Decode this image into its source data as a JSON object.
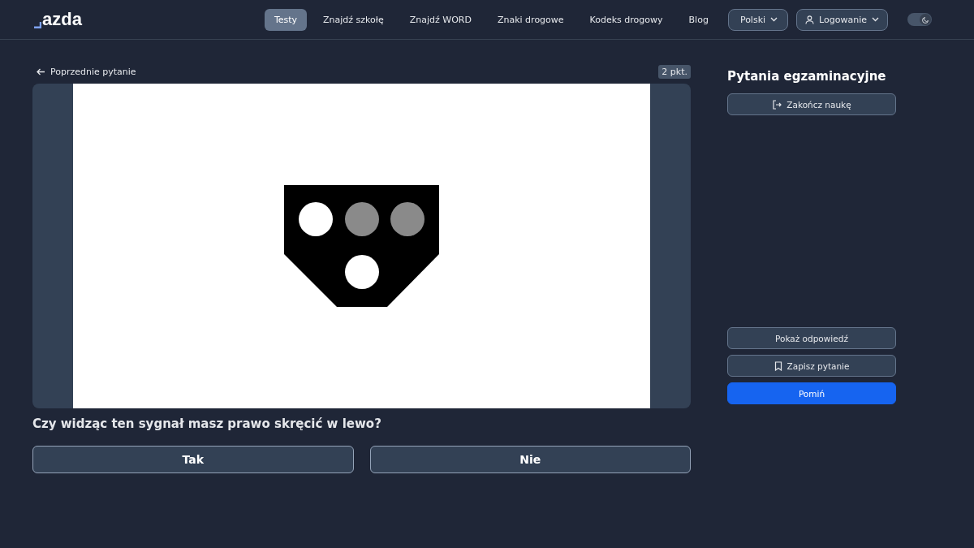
{
  "header": {
    "logo": "azda",
    "nav": [
      {
        "label": "Testy",
        "selected": true
      },
      {
        "label": "Znajdź szkołę",
        "selected": false
      },
      {
        "label": "Znajdź WORD",
        "selected": false
      },
      {
        "label": "Znaki drogowe",
        "selected": false
      },
      {
        "label": "Kodeks drogowy",
        "selected": false
      },
      {
        "label": "Blog",
        "selected": false
      }
    ],
    "language": "Polski",
    "login": "Logowanie",
    "theme_toggle": {
      "on": true
    }
  },
  "question": {
    "back_link": "Poprzednie pytanie",
    "points": "2 pkt.",
    "text": "Czy widząc ten sygnał masz prawo skręcić w lewo?",
    "answers": [
      "Tak",
      "Nie"
    ]
  },
  "sidebar": {
    "title": "Pytania egzaminacyjne",
    "top_buttons": [
      {
        "label": "Zakończ naukę",
        "kind": "exit"
      }
    ],
    "bottom_buttons": [
      {
        "label": "Pokaż odpowiedź",
        "kind": "plain"
      },
      {
        "label": "Zapisz pytanie",
        "kind": "bookmark"
      },
      {
        "label": "Pomiń",
        "kind": "primary"
      }
    ]
  }
}
